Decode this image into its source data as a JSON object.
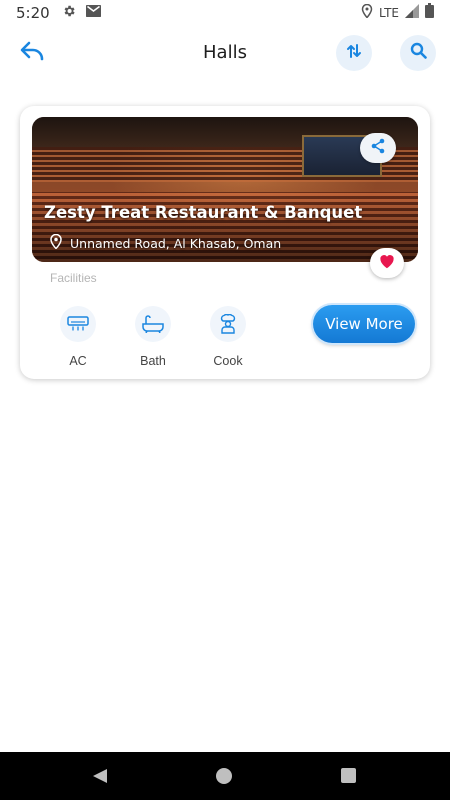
{
  "status_bar": {
    "time": "5:20",
    "network": "LTE",
    "icons": [
      "settings-icon",
      "mail-icon",
      "location-icon",
      "signal-icon",
      "battery-icon"
    ]
  },
  "app_bar": {
    "title": "Halls",
    "icons": [
      "back-icon",
      "sort-icon",
      "search-icon"
    ]
  },
  "colors": {
    "accent": "#1a86e0",
    "heart": "#e8174f",
    "icon_bg": "#e8f1fa"
  },
  "hall": {
    "name": "Zesty Treat Restaurant & Banquet",
    "location": "Unnamed Road, Al Khasab, Oman",
    "facilities_label": "Facilities",
    "facilities": [
      {
        "label": "AC",
        "icon": "ac-icon"
      },
      {
        "label": "Bath",
        "icon": "bathtub-icon"
      },
      {
        "label": "Cook",
        "icon": "chef-icon"
      }
    ],
    "view_more_label": "View More"
  }
}
